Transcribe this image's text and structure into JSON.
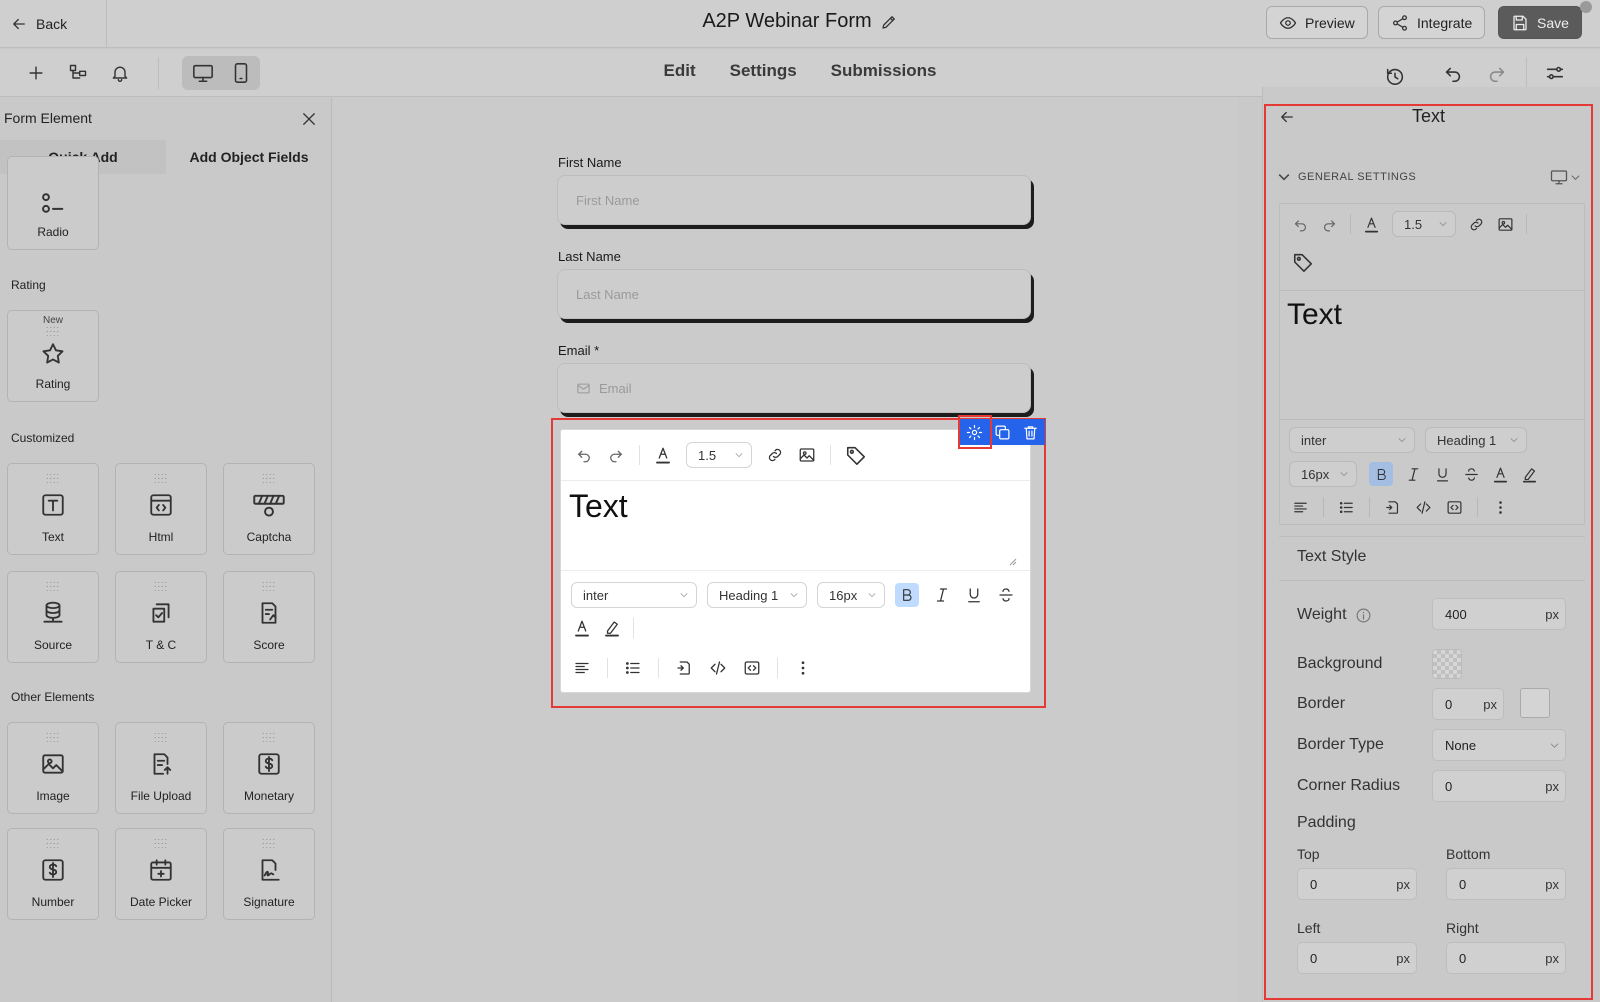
{
  "header": {
    "back_label": "Back",
    "form_title": "A2P Webinar Form",
    "preview_label": "Preview",
    "integrate_label": "Integrate",
    "save_label": "Save"
  },
  "mode_tabs": [
    "Edit",
    "Settings",
    "Submissions"
  ],
  "left_panel": {
    "title": "Form Element",
    "tabs": [
      "Quick Add",
      "Add Object Fields"
    ],
    "sections": {
      "rating": "Rating",
      "customized": "Customized",
      "other": "Other Elements"
    },
    "new_badge": "New",
    "tiles": {
      "radio": "Radio",
      "rating": "Rating",
      "text": "Text",
      "html": "Html",
      "captcha": "Captcha",
      "source": "Source",
      "tc": "T & C",
      "score": "Score",
      "image": "Image",
      "file_upload": "File Upload",
      "monetary": "Monetary",
      "number": "Number",
      "date_picker": "Date Picker",
      "signature": "Signature"
    }
  },
  "form": {
    "first_name_label": "First Name",
    "first_name_placeholder": "First Name",
    "last_name_label": "Last Name",
    "last_name_placeholder": "Last Name",
    "email_label": "Email *",
    "email_placeholder": "Email"
  },
  "editor": {
    "line_height": "1.5",
    "content": "Text",
    "font": "inter",
    "heading": "Heading 1",
    "size": "16px"
  },
  "right_panel": {
    "title": "Text",
    "section": "GENERAL SETTINGS",
    "line_height": "1.5",
    "preview_text": "Text",
    "font": "inter",
    "heading": "Heading 1",
    "size": "16px",
    "text_style_title": "Text Style",
    "weight_label": "Weight",
    "weight_value": "400",
    "background_label": "Background",
    "border_label": "Border",
    "border_value": "0",
    "border_type_label": "Border Type",
    "border_type_value": "None",
    "corner_radius_label": "Corner Radius",
    "corner_radius_value": "0",
    "padding_label": "Padding",
    "top_label": "Top",
    "top_value": "0",
    "bottom_label": "Bottom",
    "bottom_value": "0",
    "left_label": "Left",
    "left_value": "0",
    "right_label": "Right",
    "right_value": "0",
    "unit": "px"
  },
  "colors": {
    "accent_blue": "#2563eb",
    "highlight_red": "#e53935",
    "save_button": "#5b5b5b"
  }
}
